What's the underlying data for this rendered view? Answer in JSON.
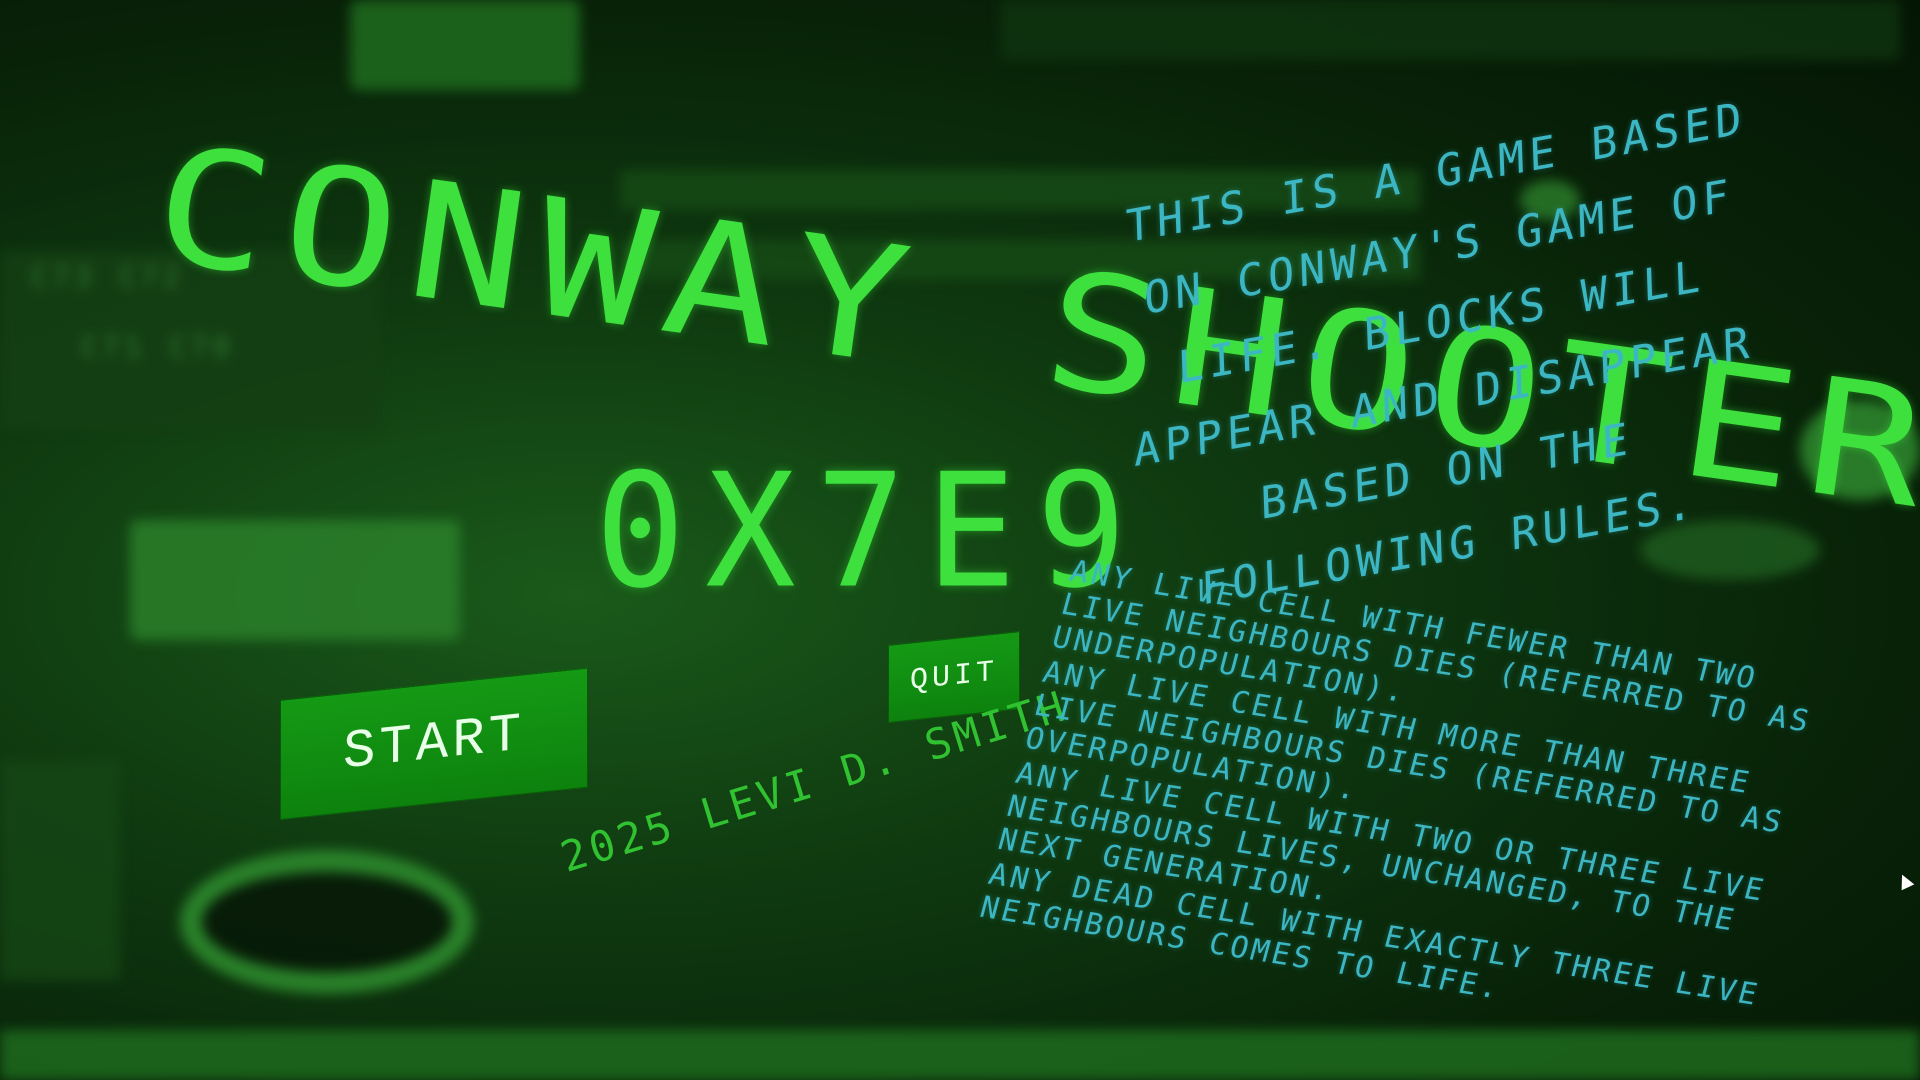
{
  "game": {
    "title": "CONWAY SHOOTER",
    "subtitle": "0X7E9",
    "credit": "2025 LEVI D. SMITH"
  },
  "buttons": {
    "start_label": "START",
    "quit_label": "QUIT"
  },
  "description": {
    "intro": "THIS IS A GAME BASED ON CONWAY'S GAME OF LIFE. BLOCKS WILL APPEAR AND DISAPPEAR BASED ON THE FOLLOWING RULES.",
    "rules": [
      "ANY LIVE CELL WITH FEWER THAN TWO LIVE NEIGHBOURS DIES (REFERRED TO AS UNDERPOPULATION).",
      "ANY LIVE CELL WITH MORE THAN THREE LIVE NEIGHBOURS DIES (REFERRED TO AS OVERPOPULATION).",
      "ANY LIVE CELL WITH TWO OR THREE LIVE NEIGHBOURS LIVES, UNCHANGED, TO THE NEXT GENERATION.",
      "ANY DEAD CELL WITH EXACTLY THREE LIVE NEIGHBOURS COMES TO LIFE."
    ]
  },
  "colors": {
    "title_green": "#3ee03e",
    "button_green": "#159a15",
    "text_cyan": "#3cb6c2",
    "background": "#0b2a0b"
  }
}
